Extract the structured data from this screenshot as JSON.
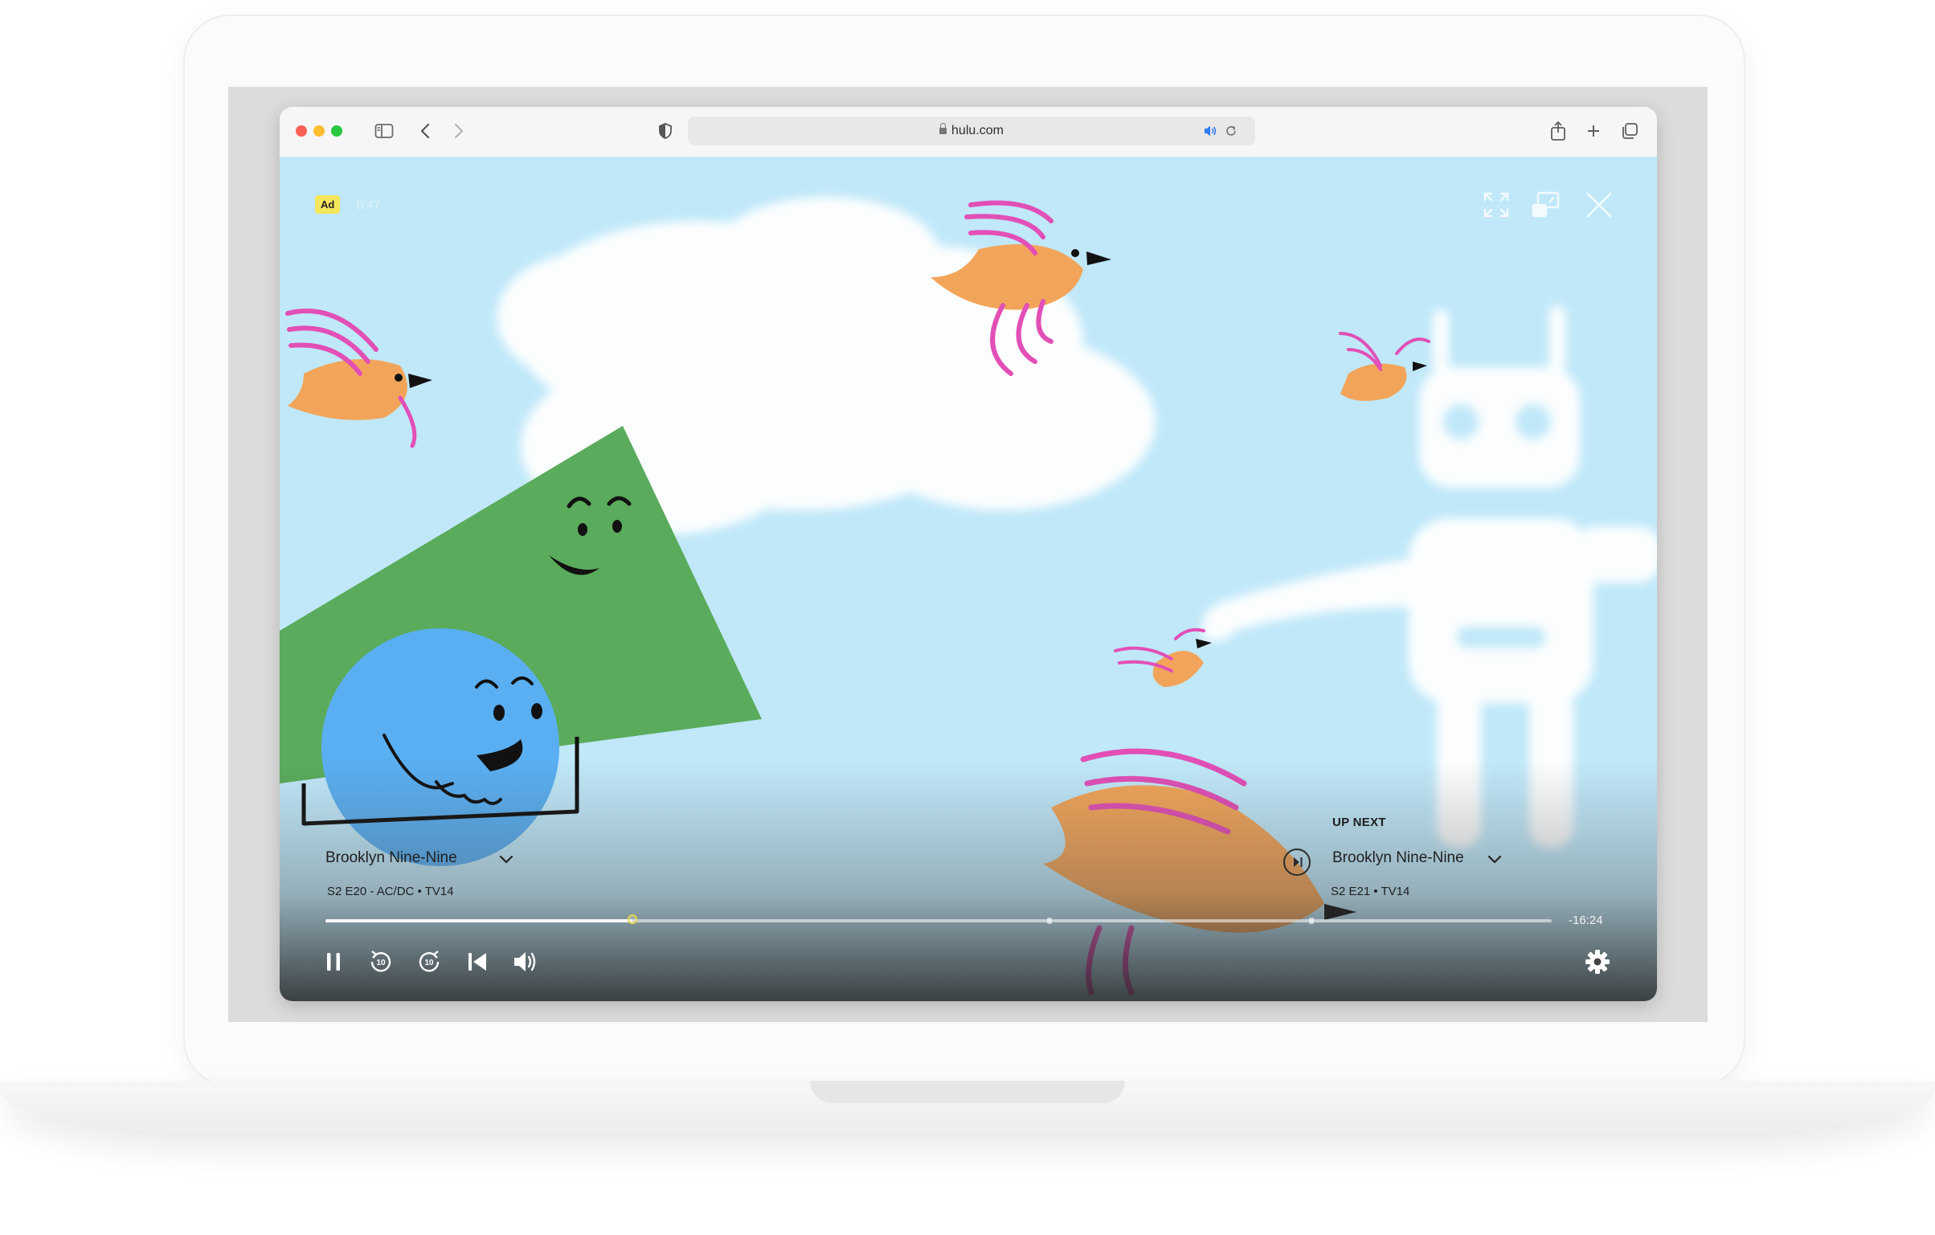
{
  "browser": {
    "url": "hulu.com"
  },
  "player": {
    "ad_badge": "Ad",
    "ad_time": "0:47",
    "show_title": "Brooklyn Nine-Nine",
    "episode_meta": "S2 E20 - AC/DC • TV14",
    "progress_fraction": 0.25,
    "time_remaining": "-16:24",
    "up_next": {
      "label": "UP NEXT",
      "title": "Brooklyn Nine-Nine",
      "meta": "S2 E21 • TV14"
    }
  },
  "icons": {
    "sidebar": "sidebar-icon",
    "back": "chevron-left-icon",
    "forward": "chevron-right-icon",
    "privacy": "shield-icon",
    "audio": "speaker-icon",
    "reload": "reload-icon",
    "share": "share-icon",
    "new_tab": "plus-icon",
    "tabs": "tabs-overview-icon",
    "fullscreen": "fullscreen-icon",
    "pip": "picture-in-picture-icon",
    "close": "close-icon",
    "pause": "pause-icon",
    "rewind": "rewind-10-icon",
    "forward10": "forward-10-icon",
    "restart": "skip-back-icon",
    "volume": "volume-icon",
    "settings": "gear-icon"
  },
  "colors": {
    "sky": "#c0e8f9",
    "ad_badge": "#f5e65b",
    "progress_knob": "#e8d94a",
    "traffic_red": "#ff5f57",
    "traffic_yellow": "#febc2e",
    "traffic_green": "#28c840"
  }
}
